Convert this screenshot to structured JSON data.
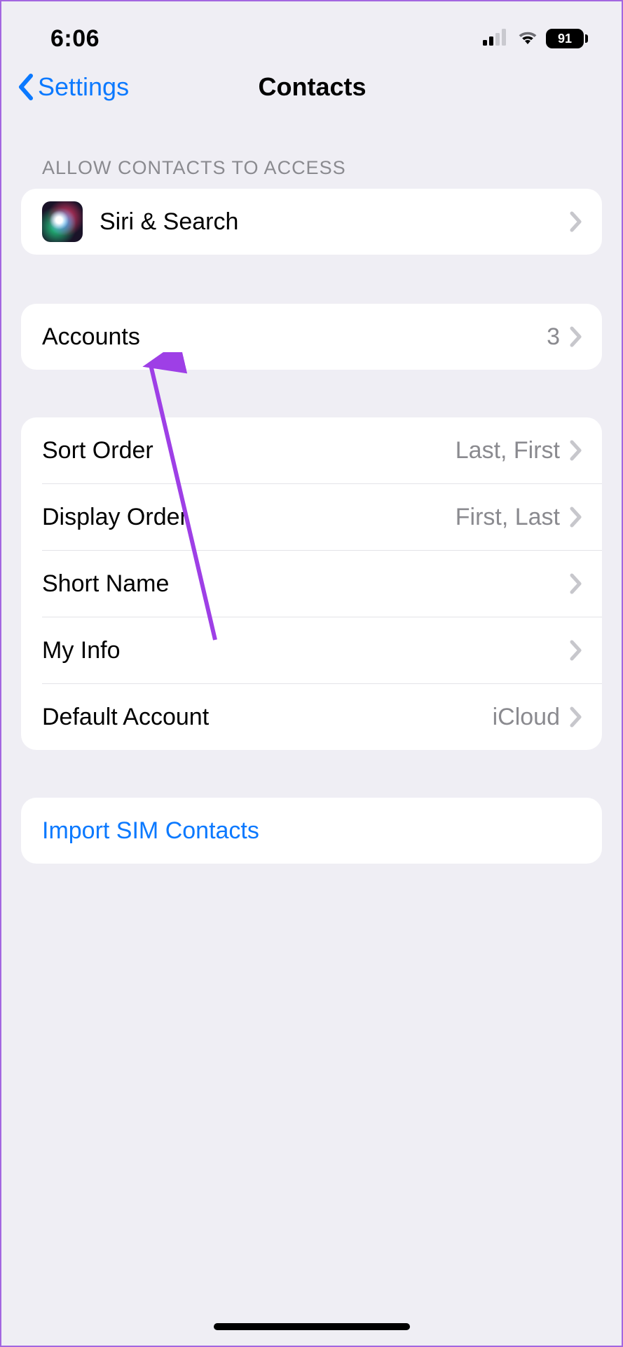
{
  "status": {
    "time": "6:06",
    "battery": "91"
  },
  "nav": {
    "back_label": "Settings",
    "title": "Contacts"
  },
  "sections": {
    "allow_header": "ALLOW CONTACTS TO ACCESS",
    "siri_label": "Siri & Search",
    "accounts_label": "Accounts",
    "accounts_value": "3",
    "sort_order_label": "Sort Order",
    "sort_order_value": "Last, First",
    "display_order_label": "Display Order",
    "display_order_value": "First, Last",
    "short_name_label": "Short Name",
    "my_info_label": "My Info",
    "default_account_label": "Default Account",
    "default_account_value": "iCloud",
    "import_sim_label": "Import SIM Contacts"
  }
}
